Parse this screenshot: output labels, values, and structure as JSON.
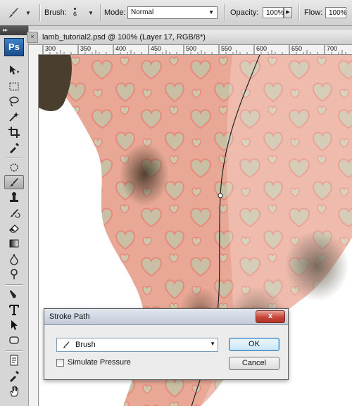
{
  "options_bar": {
    "brush_label": "Brush:",
    "brush_size": "6",
    "mode_label": "Mode:",
    "mode_value": "Normal",
    "opacity_label": "Opacity:",
    "opacity_value": "100%",
    "flow_label": "Flow:",
    "flow_value": "100%"
  },
  "tools": {
    "logo": "Ps"
  },
  "document": {
    "title": "lamb_tutorial2.psd @ 100% (Layer 17, RGB/8*)",
    "ruler_ticks": [
      "300",
      "350",
      "400",
      "450",
      "500",
      "550",
      "600",
      "650",
      "700"
    ]
  },
  "dialog": {
    "title": "Stroke Path",
    "close": "x",
    "tool_select": "Brush",
    "simulate_pressure": "Simulate Pressure",
    "simulate_pressure_checked": false,
    "ok": "OK",
    "cancel": "Cancel"
  },
  "colors": {
    "fabric_pink": "#e9a896",
    "heart_beige": "#c9bfa4",
    "close_red": "#c7463a"
  }
}
